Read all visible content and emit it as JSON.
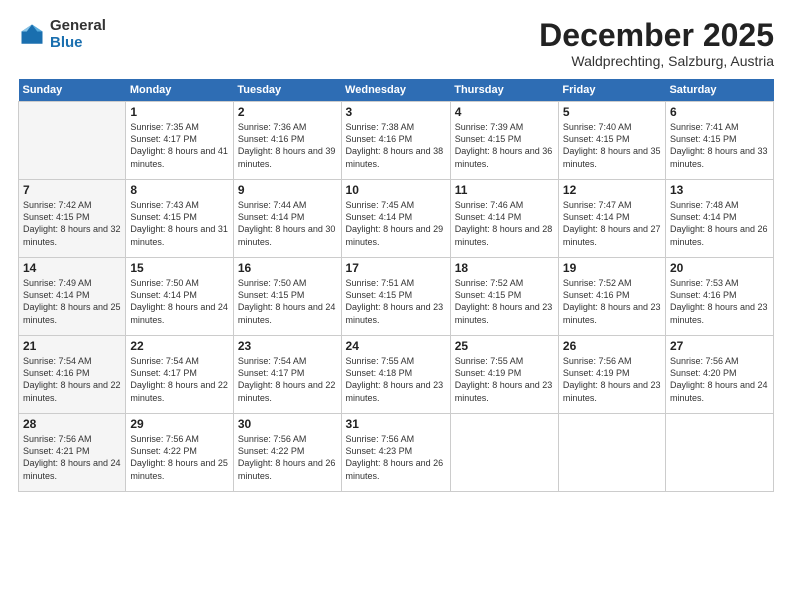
{
  "logo": {
    "general": "General",
    "blue": "Blue"
  },
  "title": "December 2025",
  "location": "Waldprechting, Salzburg, Austria",
  "days_header": [
    "Sunday",
    "Monday",
    "Tuesday",
    "Wednesday",
    "Thursday",
    "Friday",
    "Saturday"
  ],
  "weeks": [
    [
      {
        "num": "",
        "sunrise": "",
        "sunset": "",
        "daylight": ""
      },
      {
        "num": "1",
        "sunrise": "Sunrise: 7:35 AM",
        "sunset": "Sunset: 4:17 PM",
        "daylight": "Daylight: 8 hours and 41 minutes."
      },
      {
        "num": "2",
        "sunrise": "Sunrise: 7:36 AM",
        "sunset": "Sunset: 4:16 PM",
        "daylight": "Daylight: 8 hours and 39 minutes."
      },
      {
        "num": "3",
        "sunrise": "Sunrise: 7:38 AM",
        "sunset": "Sunset: 4:16 PM",
        "daylight": "Daylight: 8 hours and 38 minutes."
      },
      {
        "num": "4",
        "sunrise": "Sunrise: 7:39 AM",
        "sunset": "Sunset: 4:15 PM",
        "daylight": "Daylight: 8 hours and 36 minutes."
      },
      {
        "num": "5",
        "sunrise": "Sunrise: 7:40 AM",
        "sunset": "Sunset: 4:15 PM",
        "daylight": "Daylight: 8 hours and 35 minutes."
      },
      {
        "num": "6",
        "sunrise": "Sunrise: 7:41 AM",
        "sunset": "Sunset: 4:15 PM",
        "daylight": "Daylight: 8 hours and 33 minutes."
      }
    ],
    [
      {
        "num": "7",
        "sunrise": "Sunrise: 7:42 AM",
        "sunset": "Sunset: 4:15 PM",
        "daylight": "Daylight: 8 hours and 32 minutes."
      },
      {
        "num": "8",
        "sunrise": "Sunrise: 7:43 AM",
        "sunset": "Sunset: 4:15 PM",
        "daylight": "Daylight: 8 hours and 31 minutes."
      },
      {
        "num": "9",
        "sunrise": "Sunrise: 7:44 AM",
        "sunset": "Sunset: 4:14 PM",
        "daylight": "Daylight: 8 hours and 30 minutes."
      },
      {
        "num": "10",
        "sunrise": "Sunrise: 7:45 AM",
        "sunset": "Sunset: 4:14 PM",
        "daylight": "Daylight: 8 hours and 29 minutes."
      },
      {
        "num": "11",
        "sunrise": "Sunrise: 7:46 AM",
        "sunset": "Sunset: 4:14 PM",
        "daylight": "Daylight: 8 hours and 28 minutes."
      },
      {
        "num": "12",
        "sunrise": "Sunrise: 7:47 AM",
        "sunset": "Sunset: 4:14 PM",
        "daylight": "Daylight: 8 hours and 27 minutes."
      },
      {
        "num": "13",
        "sunrise": "Sunrise: 7:48 AM",
        "sunset": "Sunset: 4:14 PM",
        "daylight": "Daylight: 8 hours and 26 minutes."
      }
    ],
    [
      {
        "num": "14",
        "sunrise": "Sunrise: 7:49 AM",
        "sunset": "Sunset: 4:14 PM",
        "daylight": "Daylight: 8 hours and 25 minutes."
      },
      {
        "num": "15",
        "sunrise": "Sunrise: 7:50 AM",
        "sunset": "Sunset: 4:14 PM",
        "daylight": "Daylight: 8 hours and 24 minutes."
      },
      {
        "num": "16",
        "sunrise": "Sunrise: 7:50 AM",
        "sunset": "Sunset: 4:15 PM",
        "daylight": "Daylight: 8 hours and 24 minutes."
      },
      {
        "num": "17",
        "sunrise": "Sunrise: 7:51 AM",
        "sunset": "Sunset: 4:15 PM",
        "daylight": "Daylight: 8 hours and 23 minutes."
      },
      {
        "num": "18",
        "sunrise": "Sunrise: 7:52 AM",
        "sunset": "Sunset: 4:15 PM",
        "daylight": "Daylight: 8 hours and 23 minutes."
      },
      {
        "num": "19",
        "sunrise": "Sunrise: 7:52 AM",
        "sunset": "Sunset: 4:16 PM",
        "daylight": "Daylight: 8 hours and 23 minutes."
      },
      {
        "num": "20",
        "sunrise": "Sunrise: 7:53 AM",
        "sunset": "Sunset: 4:16 PM",
        "daylight": "Daylight: 8 hours and 23 minutes."
      }
    ],
    [
      {
        "num": "21",
        "sunrise": "Sunrise: 7:54 AM",
        "sunset": "Sunset: 4:16 PM",
        "daylight": "Daylight: 8 hours and 22 minutes."
      },
      {
        "num": "22",
        "sunrise": "Sunrise: 7:54 AM",
        "sunset": "Sunset: 4:17 PM",
        "daylight": "Daylight: 8 hours and 22 minutes."
      },
      {
        "num": "23",
        "sunrise": "Sunrise: 7:54 AM",
        "sunset": "Sunset: 4:17 PM",
        "daylight": "Daylight: 8 hours and 22 minutes."
      },
      {
        "num": "24",
        "sunrise": "Sunrise: 7:55 AM",
        "sunset": "Sunset: 4:18 PM",
        "daylight": "Daylight: 8 hours and 23 minutes."
      },
      {
        "num": "25",
        "sunrise": "Sunrise: 7:55 AM",
        "sunset": "Sunset: 4:19 PM",
        "daylight": "Daylight: 8 hours and 23 minutes."
      },
      {
        "num": "26",
        "sunrise": "Sunrise: 7:56 AM",
        "sunset": "Sunset: 4:19 PM",
        "daylight": "Daylight: 8 hours and 23 minutes."
      },
      {
        "num": "27",
        "sunrise": "Sunrise: 7:56 AM",
        "sunset": "Sunset: 4:20 PM",
        "daylight": "Daylight: 8 hours and 24 minutes."
      }
    ],
    [
      {
        "num": "28",
        "sunrise": "Sunrise: 7:56 AM",
        "sunset": "Sunset: 4:21 PM",
        "daylight": "Daylight: 8 hours and 24 minutes."
      },
      {
        "num": "29",
        "sunrise": "Sunrise: 7:56 AM",
        "sunset": "Sunset: 4:22 PM",
        "daylight": "Daylight: 8 hours and 25 minutes."
      },
      {
        "num": "30",
        "sunrise": "Sunrise: 7:56 AM",
        "sunset": "Sunset: 4:22 PM",
        "daylight": "Daylight: 8 hours and 26 minutes."
      },
      {
        "num": "31",
        "sunrise": "Sunrise: 7:56 AM",
        "sunset": "Sunset: 4:23 PM",
        "daylight": "Daylight: 8 hours and 26 minutes."
      },
      {
        "num": "",
        "sunrise": "",
        "sunset": "",
        "daylight": ""
      },
      {
        "num": "",
        "sunrise": "",
        "sunset": "",
        "daylight": ""
      },
      {
        "num": "",
        "sunrise": "",
        "sunset": "",
        "daylight": ""
      }
    ]
  ]
}
